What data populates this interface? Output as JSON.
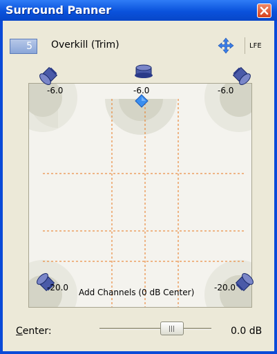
{
  "window": {
    "title": "Surround Panner"
  },
  "toolbar": {
    "channel_number": "5",
    "track_name": "Overkill (Trim)",
    "lfe_label": "LFE"
  },
  "pad": {
    "front_left_db": "-6.0",
    "front_center_db": "-6.0",
    "front_right_db": "-6.0",
    "rear_left_db": "-20.0",
    "rear_right_db": "-20.0",
    "mode_label": "Add Channels (0 dB Center)"
  },
  "center": {
    "label_prefix": "C",
    "label_rest": "enter:",
    "value": "0.0 dB",
    "slider_level": 0.65
  },
  "icons": [
    "close-icon",
    "move-icon",
    "speaker-icon",
    "pan-point-icon"
  ],
  "colors": {
    "titlebar": "#0a52dc",
    "grid": "#e8761a",
    "pan_point": "#3a8ef0",
    "panel": "#ece9d8"
  }
}
